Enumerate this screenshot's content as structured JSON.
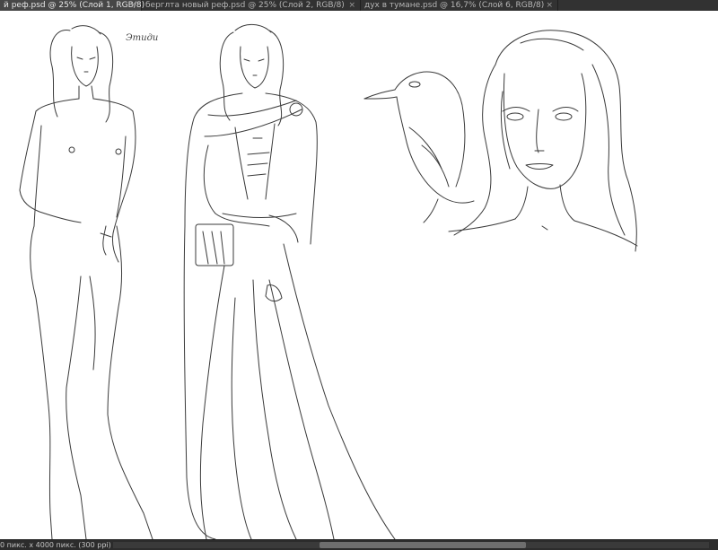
{
  "tabs": [
    {
      "label": "й реф.psd @ 25% (Слой 1, RGB/8)",
      "active": true
    },
    {
      "label": "берглта новый реф.psd @ 25% (Слой 2, RGB/8)",
      "active": false
    },
    {
      "label": "дух в тумане.psd @ 16,7% (Слой 6, RGB/8)",
      "active": false
    }
  ],
  "close_glyph": "×",
  "canvas": {
    "signature": "Этиди",
    "description_icons": [
      "figure-sketch",
      "dressed-figure-sketch",
      "bird-sketch",
      "portrait-sketch"
    ]
  },
  "status": {
    "doc_info": "0 пикс. x 4000 пикс. (300 ppi)",
    "arrow": "›",
    "scroll_position": 0.35
  }
}
